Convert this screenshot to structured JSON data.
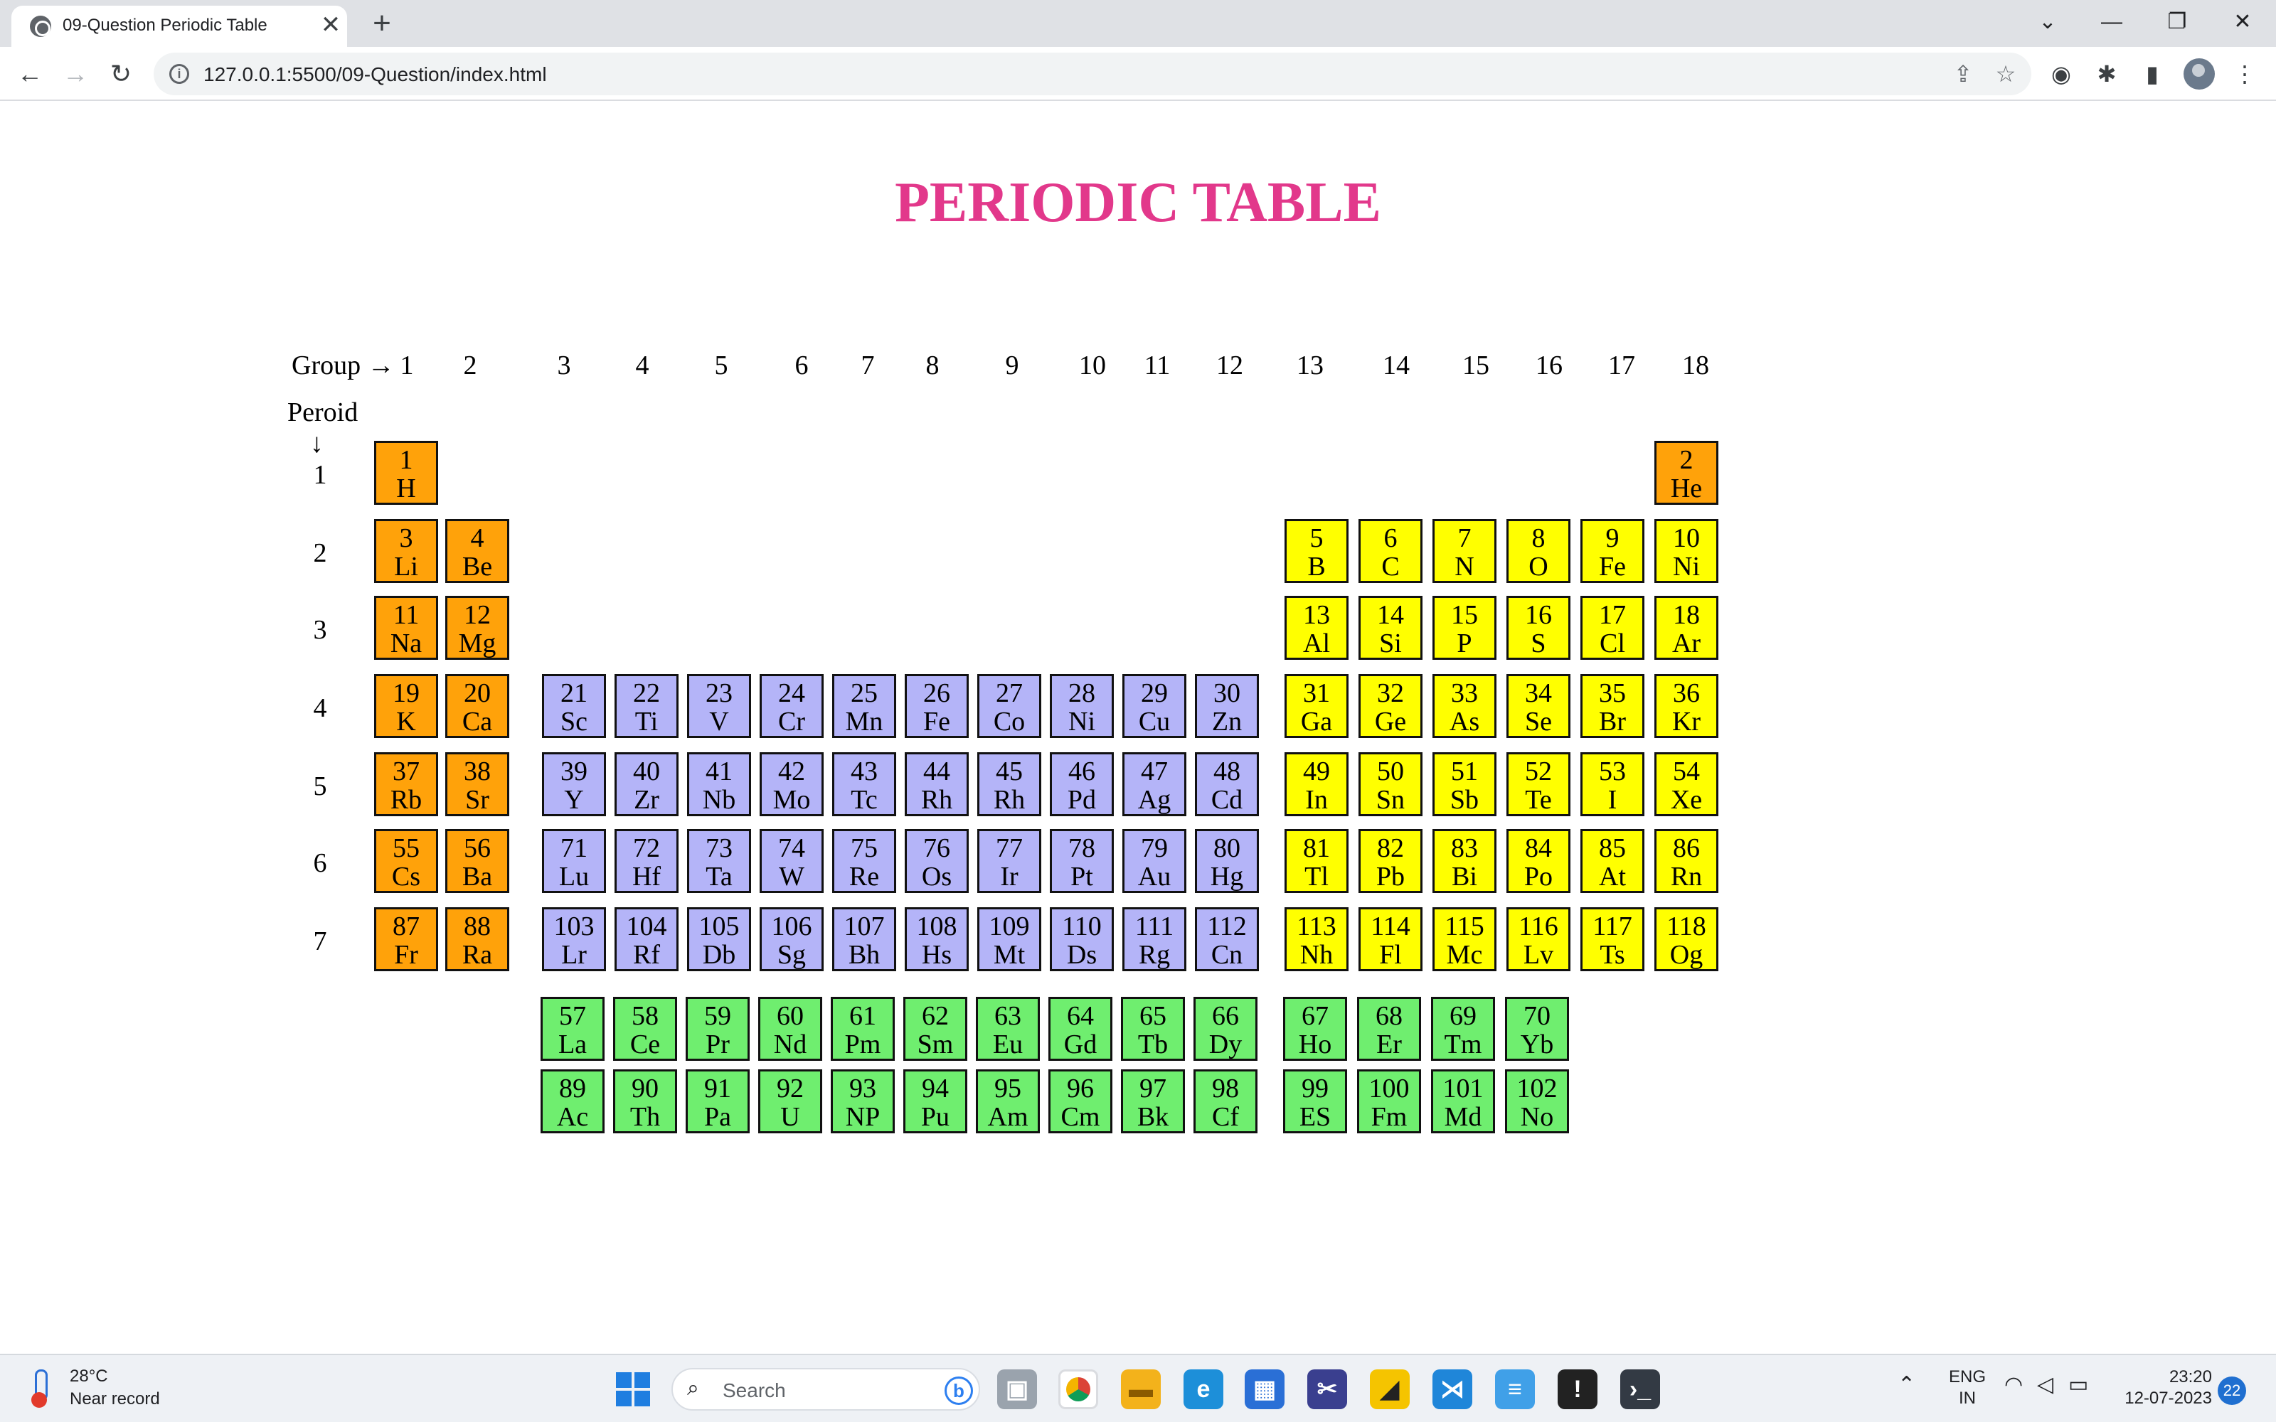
{
  "browser": {
    "tab_title": "09-Question Periodic Table",
    "tab_close": "✕",
    "new_tab": "+",
    "url": "127.0.0.1:5500/09-Question/index.html",
    "window_controls": [
      "⌄",
      "—",
      "❐",
      "✕"
    ]
  },
  "page": {
    "title": "PERIODIC TABLE",
    "group_label": "Group →",
    "period_label": "Peroid",
    "period_arrow": "↓",
    "groups": [
      "1",
      "2",
      "3",
      "4",
      "5",
      "6",
      "7",
      "8",
      "9",
      "10",
      "11",
      "12",
      "13",
      "14",
      "15",
      "16",
      "17",
      "18"
    ],
    "periods": [
      "1",
      "2",
      "3",
      "4",
      "5",
      "6",
      "7"
    ],
    "colors": {
      "alkali": "#ffa20a",
      "transition": "#b4b4f8",
      "main": "#ffff00",
      "f_block": "#6fee6f",
      "title": "#e2388b"
    },
    "rows": [
      [
        {
          "n": "1",
          "s": "H",
          "c": "alkali"
        },
        {
          "n": "2",
          "s": "He",
          "c": "alkali"
        }
      ],
      [
        {
          "n": "3",
          "s": "Li",
          "c": "alkali"
        },
        {
          "n": "4",
          "s": "Be",
          "c": "alkali"
        },
        {
          "n": "5",
          "s": "B",
          "c": "main"
        },
        {
          "n": "6",
          "s": "C",
          "c": "main"
        },
        {
          "n": "7",
          "s": "N",
          "c": "main"
        },
        {
          "n": "8",
          "s": "O",
          "c": "main"
        },
        {
          "n": "9",
          "s": "Fe",
          "c": "main"
        },
        {
          "n": "10",
          "s": "Ni",
          "c": "main"
        }
      ],
      [
        {
          "n": "11",
          "s": "Na",
          "c": "alkali"
        },
        {
          "n": "12",
          "s": "Mg",
          "c": "alkali"
        },
        {
          "n": "13",
          "s": "Al",
          "c": "main"
        },
        {
          "n": "14",
          "s": "Si",
          "c": "main"
        },
        {
          "n": "15",
          "s": "P",
          "c": "main"
        },
        {
          "n": "16",
          "s": "S",
          "c": "main"
        },
        {
          "n": "17",
          "s": "Cl",
          "c": "main"
        },
        {
          "n": "18",
          "s": "Ar",
          "c": "main"
        }
      ],
      [
        {
          "n": "19",
          "s": "K",
          "c": "alkali"
        },
        {
          "n": "20",
          "s": "Ca",
          "c": "alkali"
        },
        {
          "n": "21",
          "s": "Sc",
          "c": "transition"
        },
        {
          "n": "22",
          "s": "Ti",
          "c": "transition"
        },
        {
          "n": "23",
          "s": "V",
          "c": "transition"
        },
        {
          "n": "24",
          "s": "Cr",
          "c": "transition"
        },
        {
          "n": "25",
          "s": "Mn",
          "c": "transition"
        },
        {
          "n": "26",
          "s": "Fe",
          "c": "transition"
        },
        {
          "n": "27",
          "s": "Co",
          "c": "transition"
        },
        {
          "n": "28",
          "s": "Ni",
          "c": "transition"
        },
        {
          "n": "29",
          "s": "Cu",
          "c": "transition"
        },
        {
          "n": "30",
          "s": "Zn",
          "c": "transition"
        },
        {
          "n": "31",
          "s": "Ga",
          "c": "main"
        },
        {
          "n": "32",
          "s": "Ge",
          "c": "main"
        },
        {
          "n": "33",
          "s": "As",
          "c": "main"
        },
        {
          "n": "34",
          "s": "Se",
          "c": "main"
        },
        {
          "n": "35",
          "s": "Br",
          "c": "main"
        },
        {
          "n": "36",
          "s": "Kr",
          "c": "main"
        }
      ],
      [
        {
          "n": "37",
          "s": "Rb",
          "c": "alkali"
        },
        {
          "n": "38",
          "s": "Sr",
          "c": "alkali"
        },
        {
          "n": "39",
          "s": "Y",
          "c": "transition"
        },
        {
          "n": "40",
          "s": "Zr",
          "c": "transition"
        },
        {
          "n": "41",
          "s": "Nb",
          "c": "transition"
        },
        {
          "n": "42",
          "s": "Mo",
          "c": "transition"
        },
        {
          "n": "43",
          "s": "Tc",
          "c": "transition"
        },
        {
          "n": "44",
          "s": "Rh",
          "c": "transition"
        },
        {
          "n": "45",
          "s": "Rh",
          "c": "transition"
        },
        {
          "n": "46",
          "s": "Pd",
          "c": "transition"
        },
        {
          "n": "47",
          "s": "Ag",
          "c": "transition"
        },
        {
          "n": "48",
          "s": "Cd",
          "c": "transition"
        },
        {
          "n": "49",
          "s": "In",
          "c": "main"
        },
        {
          "n": "50",
          "s": "Sn",
          "c": "main"
        },
        {
          "n": "51",
          "s": "Sb",
          "c": "main"
        },
        {
          "n": "52",
          "s": "Te",
          "c": "main"
        },
        {
          "n": "53",
          "s": "I",
          "c": "main"
        },
        {
          "n": "54",
          "s": "Xe",
          "c": "main"
        }
      ],
      [
        {
          "n": "55",
          "s": "Cs",
          "c": "alkali"
        },
        {
          "n": "56",
          "s": "Ba",
          "c": "alkali"
        },
        {
          "n": "71",
          "s": "Lu",
          "c": "transition"
        },
        {
          "n": "72",
          "s": "Hf",
          "c": "transition"
        },
        {
          "n": "73",
          "s": "Ta",
          "c": "transition"
        },
        {
          "n": "74",
          "s": "W",
          "c": "transition"
        },
        {
          "n": "75",
          "s": "Re",
          "c": "transition"
        },
        {
          "n": "76",
          "s": "Os",
          "c": "transition"
        },
        {
          "n": "77",
          "s": "Ir",
          "c": "transition"
        },
        {
          "n": "78",
          "s": "Pt",
          "c": "transition"
        },
        {
          "n": "79",
          "s": "Au",
          "c": "transition"
        },
        {
          "n": "80",
          "s": "Hg",
          "c": "transition"
        },
        {
          "n": "81",
          "s": "Tl",
          "c": "main"
        },
        {
          "n": "82",
          "s": "Pb",
          "c": "main"
        },
        {
          "n": "83",
          "s": "Bi",
          "c": "main"
        },
        {
          "n": "84",
          "s": "Po",
          "c": "main"
        },
        {
          "n": "85",
          "s": "At",
          "c": "main"
        },
        {
          "n": "86",
          "s": "Rn",
          "c": "main"
        }
      ],
      [
        {
          "n": "87",
          "s": "Fr",
          "c": "alkali"
        },
        {
          "n": "88",
          "s": "Ra",
          "c": "alkali"
        },
        {
          "n": "103",
          "s": "Lr",
          "c": "transition"
        },
        {
          "n": "104",
          "s": "Rf",
          "c": "transition"
        },
        {
          "n": "105",
          "s": "Db",
          "c": "transition"
        },
        {
          "n": "106",
          "s": "Sg",
          "c": "transition"
        },
        {
          "n": "107",
          "s": "Bh",
          "c": "transition"
        },
        {
          "n": "108",
          "s": "Hs",
          "c": "transition"
        },
        {
          "n": "109",
          "s": "Mt",
          "c": "transition"
        },
        {
          "n": "110",
          "s": "Ds",
          "c": "transition"
        },
        {
          "n": "111",
          "s": "Rg",
          "c": "transition"
        },
        {
          "n": "112",
          "s": "Cn",
          "c": "transition"
        },
        {
          "n": "113",
          "s": "Nh",
          "c": "main"
        },
        {
          "n": "114",
          "s": "Fl",
          "c": "main"
        },
        {
          "n": "115",
          "s": "Mc",
          "c": "main"
        },
        {
          "n": "116",
          "s": "Lv",
          "c": "main"
        },
        {
          "n": "117",
          "s": "Ts",
          "c": "main"
        },
        {
          "n": "118",
          "s": "Og",
          "c": "main"
        }
      ]
    ],
    "f_rows": [
      [
        {
          "n": "57",
          "s": "La"
        },
        {
          "n": "58",
          "s": "Ce"
        },
        {
          "n": "59",
          "s": "Pr"
        },
        {
          "n": "60",
          "s": "Nd"
        },
        {
          "n": "61",
          "s": "Pm"
        },
        {
          "n": "62",
          "s": "Sm"
        },
        {
          "n": "63",
          "s": "Eu"
        },
        {
          "n": "64",
          "s": "Gd"
        },
        {
          "n": "65",
          "s": "Tb"
        },
        {
          "n": "66",
          "s": "Dy"
        },
        {
          "n": "67",
          "s": "Ho"
        },
        {
          "n": "68",
          "s": "Er"
        },
        {
          "n": "69",
          "s": "Tm"
        },
        {
          "n": "70",
          "s": "Yb"
        }
      ],
      [
        {
          "n": "89",
          "s": "Ac"
        },
        {
          "n": "90",
          "s": "Th"
        },
        {
          "n": "91",
          "s": "Pa"
        },
        {
          "n": "92",
          "s": "U"
        },
        {
          "n": "93",
          "s": "NP"
        },
        {
          "n": "94",
          "s": "Pu"
        },
        {
          "n": "95",
          "s": "Am"
        },
        {
          "n": "96",
          "s": "Cm"
        },
        {
          "n": "97",
          "s": "Bk"
        },
        {
          "n": "98",
          "s": "Cf"
        },
        {
          "n": "99",
          "s": "ES"
        },
        {
          "n": "100",
          "s": "Fm"
        },
        {
          "n": "101",
          "s": "Md"
        },
        {
          "n": "102",
          "s": "No"
        }
      ]
    ]
  },
  "taskbar": {
    "temperature": "28°C",
    "weather": "Near record",
    "search_placeholder": "Search",
    "language_top": "ENG",
    "language_bottom": "IN",
    "time": "23:20",
    "date": "12-07-2023",
    "notifications": "22"
  }
}
